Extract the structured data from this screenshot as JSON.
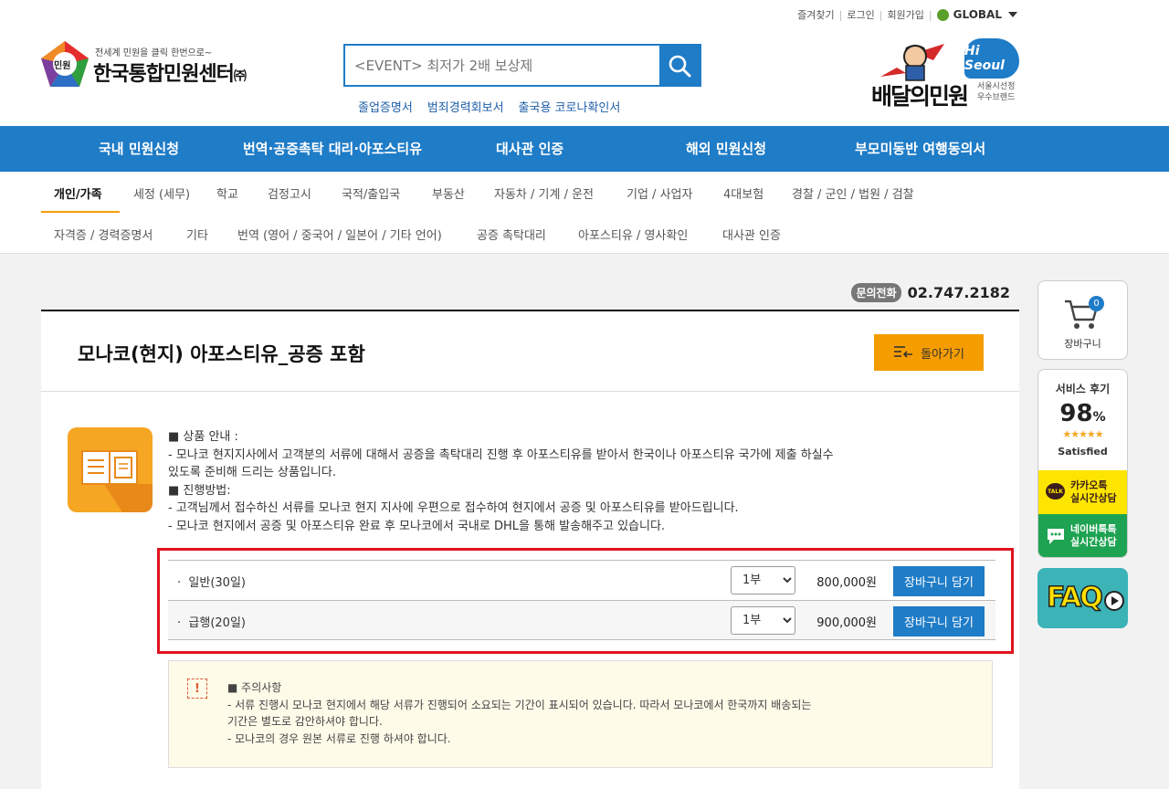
{
  "toplinks": {
    "favorite": "즐겨찾기",
    "login": "로그인",
    "join": "회원가입",
    "global": "GLOBAL"
  },
  "logo": {
    "slogan": "전세계 민원을 클릭 한번으로~",
    "name": "한국통합민원센터",
    "suffix": "㈜",
    "mark": "민원"
  },
  "search": {
    "placeholder": "<EVENT> 최저가 2배 보상제"
  },
  "quick_links": [
    "졸업증명서",
    "범죄경력회보서",
    "출국용 코로나확인서"
  ],
  "brand": {
    "badge": "Hi Seoul",
    "name": "배달의민원",
    "tag1": "서울시선정",
    "tag2": "우수브랜드"
  },
  "gnb": [
    "국내 민원신청",
    "번역·공증촉탁 대리·아포스티유",
    "대사관 인증",
    "해외 민원신청",
    "부모미동반 여행동의서"
  ],
  "subnav_row1": [
    "개인/가족",
    "세정 (세무)",
    "학교",
    "검정고시",
    "국적/출입국",
    "부동산",
    "자동차 / 기계 / 운전",
    "기업 / 사업자",
    "4대보험",
    "경찰 / 군인 / 법원 / 검찰"
  ],
  "subnav_row2": [
    "자격증 / 경력증명서",
    "기타",
    "번역 (영어 / 중국어 / 일본어 / 기타 언어)",
    "공증 촉탁대리",
    "아포스티유 / 영사확인",
    "대사관 인증"
  ],
  "contact": {
    "badge": "문의전화",
    "phone": "02.747.2182"
  },
  "product": {
    "title": "모나코(현지) 아포스티유_공증 포함",
    "back_label": "돌아가기",
    "desc": [
      "■ 상품 안내 :",
      "- 모나코 현지지사에서 고객분의 서류에 대해서 공증을 촉탁대리 진행 후 아포스티유를 받아서 한국이나 아포스티유 국가에 제출 하실수",
      "있도록 준비해 드리는 상품입니다.",
      "■ 진행방법:",
      "- 고객님께서 접수하신 서류를 모나코 현지 지사에 우편으로 접수하여 현지에서 공증 및 아포스티유를 받아드립니다.",
      "- 모나코 현지에서 공증 및 아포스티유 완료 후 모나코에서 국내로 DHL을 통해 발송해주고 있습니다."
    ],
    "options": [
      {
        "label": "일반(30일)",
        "qty": "1부",
        "price": "800,000원",
        "cart": "장바구니 담기"
      },
      {
        "label": "급행(20일)",
        "qty": "1부",
        "price": "900,000원",
        "cart": "장바구니 담기"
      }
    ]
  },
  "notice": {
    "icon": "!",
    "lines": [
      "■ 주의사항",
      "- 서류 진행시 모나코 현지에서 해당 서류가 진행되어 소요되는 기간이 표시되어 있습니다. 따라서 모나코에서 한국까지 배송되는",
      "기간은 별도로 감안하셔야 합니다.",
      "- 모나코의 경우 원본 서류로 진행 하셔야 합니다."
    ]
  },
  "quick_menu": {
    "cart_count": "0",
    "cart_label": "장바구니",
    "review_title": "서비스 후기",
    "review_pct": "98",
    "review_unit": "%",
    "review_stars": "★★★★★",
    "review_sat": "Satisfied",
    "kakao_icon": "TALK",
    "kakao1": "카카오톡",
    "kakao2": "실시간상담",
    "naver1": "네이버톡톡",
    "naver2": "실시간상담",
    "faq": "FAQ"
  }
}
